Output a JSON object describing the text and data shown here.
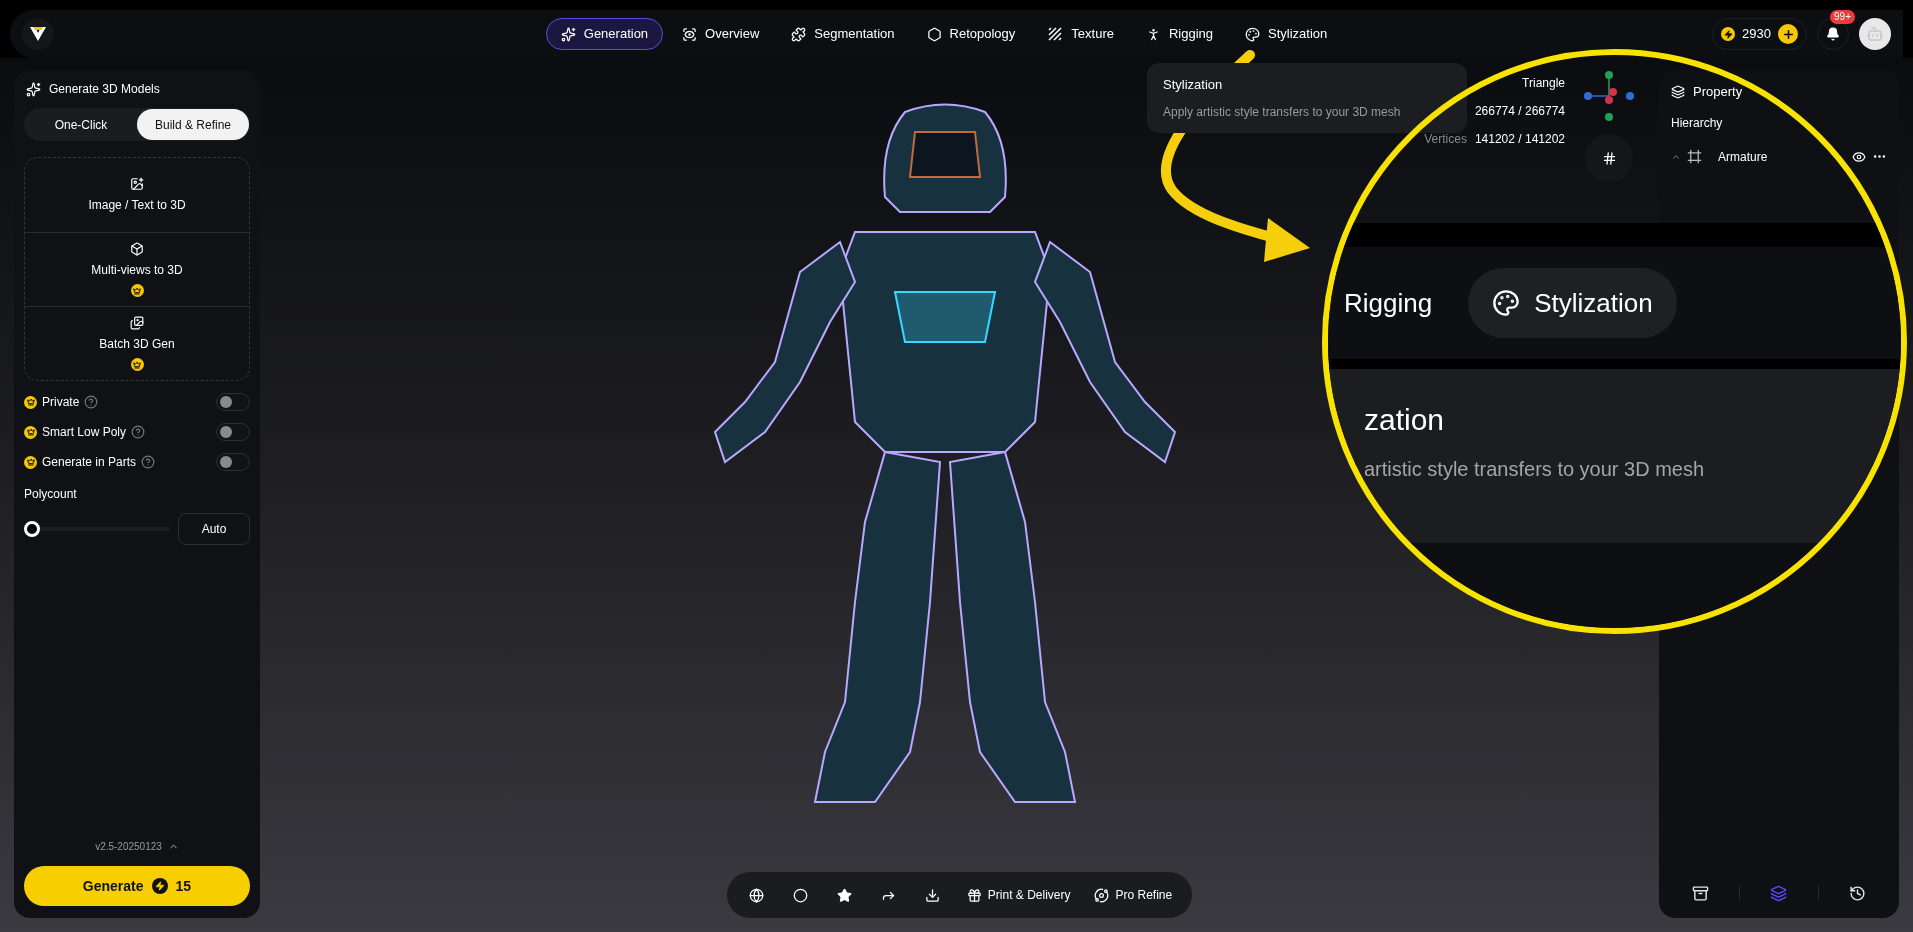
{
  "nav_tabs": [
    {
      "label": "Generation",
      "selected": true
    },
    {
      "label": "Overview",
      "selected": false
    },
    {
      "label": "Segmentation",
      "selected": false
    },
    {
      "label": "Retopology",
      "selected": false
    },
    {
      "label": "Texture",
      "selected": false
    },
    {
      "label": "Rigging",
      "selected": false
    },
    {
      "label": "Stylization",
      "selected": false
    }
  ],
  "credits": "2930",
  "notifications_badge": "99+",
  "left_panel": {
    "title": "Generate 3D Models",
    "modes": [
      {
        "label": "One-Click",
        "selected": false
      },
      {
        "label": "Build & Refine",
        "selected": true
      }
    ],
    "sources": [
      {
        "label": "Image / Text to 3D",
        "premium": false
      },
      {
        "label": "Multi-views to 3D",
        "premium": true
      },
      {
        "label": "Batch 3D Gen",
        "premium": true
      }
    ],
    "options": [
      {
        "label": "Private",
        "premium": true,
        "on": false
      },
      {
        "label": "Smart Low Poly",
        "premium": true,
        "on": false
      },
      {
        "label": "Generate in Parts",
        "premium": true,
        "on": false
      }
    ],
    "polycount": {
      "label": "Polycount",
      "level": 0,
      "button": "Auto"
    },
    "version": "v2.5-20250123",
    "generate": {
      "label": "Generate",
      "cost": "15"
    }
  },
  "tooltip": {
    "title": "Stylization",
    "text": "Apply artistic style transfers to your 3D mesh"
  },
  "stats": [
    {
      "value": "Triangle"
    },
    {
      "value": "266774 / 266774"
    },
    {
      "label": "Vertices",
      "value": "141202 / 141202"
    }
  ],
  "right_panel": {
    "title": "Property",
    "section": "Hierarchy",
    "items": [
      {
        "label": "Armature",
        "expanded": true,
        "visible": true
      }
    ],
    "footer_tabs": [
      {
        "kind": "archive",
        "selected": false
      },
      {
        "kind": "layers",
        "selected": true
      },
      {
        "kind": "history",
        "selected": false
      }
    ]
  },
  "bottom_toolbar": {
    "icon_buttons": [
      {
        "kind": "globe"
      },
      {
        "kind": "circle"
      },
      {
        "kind": "star"
      },
      {
        "kind": "share"
      },
      {
        "kind": "download"
      }
    ],
    "buttons": [
      {
        "kind": "gift",
        "label": "Print & Delivery"
      },
      {
        "kind": "planet",
        "label": "Pro Refine"
      }
    ]
  },
  "magnifier": {
    "tabs": [
      {
        "label": "Rigging",
        "selected": false
      },
      {
        "label": "Stylization",
        "selected": true
      }
    ],
    "tooltip_title": "zation",
    "tooltip_text": "artistic style transfers to your 3D mesh"
  }
}
